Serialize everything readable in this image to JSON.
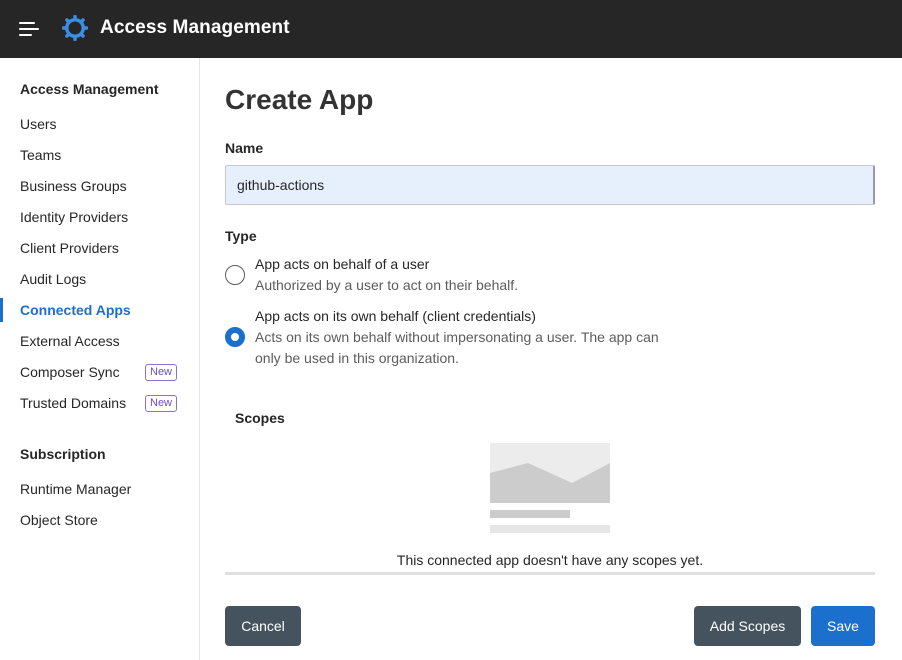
{
  "header": {
    "title": "Access Management",
    "menu_icon": "hamburger-icon",
    "logo_icon": "gear-logo-icon"
  },
  "sidebar": {
    "section1_title": "Access Management",
    "items": [
      {
        "label": "Users"
      },
      {
        "label": "Teams"
      },
      {
        "label": "Business Groups"
      },
      {
        "label": "Identity Providers"
      },
      {
        "label": "Client Providers"
      },
      {
        "label": "Audit Logs"
      },
      {
        "label": "Connected Apps",
        "active": true
      },
      {
        "label": "External Access"
      },
      {
        "label": "Composer Sync",
        "badge": "New"
      },
      {
        "label": "Trusted Domains",
        "badge": "New"
      }
    ],
    "section2_title": "Subscription",
    "items2": [
      {
        "label": "Runtime Manager"
      },
      {
        "label": "Object Store"
      }
    ]
  },
  "main": {
    "title": "Create App",
    "name_label": "Name",
    "name_value": "github-actions",
    "type_label": "Type",
    "options": [
      {
        "title": "App acts on behalf of a user",
        "description": "Authorized by a user to act on their behalf.",
        "selected": false
      },
      {
        "title": "App acts on its own behalf (client credentials)",
        "description_line1": "Acts on its own behalf without impersonating a user. The app can",
        "description_line2": "only be used in this organization.",
        "selected": true
      }
    ],
    "scopes_label": "Scopes",
    "scopes_empty": "This connected app doesn't have any scopes yet.",
    "cancel_label": "Cancel",
    "add_scopes_label": "Add Scopes",
    "save_label": "Save"
  },
  "colors": {
    "topbar": "#262626",
    "accent": "#1b6fcd",
    "logo": "#3a8ee6",
    "button_dark": "#45535e",
    "input_bg": "#e6f0fd"
  }
}
